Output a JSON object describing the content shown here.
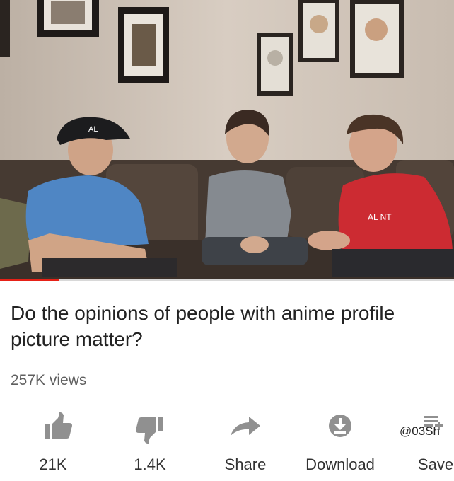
{
  "video": {
    "scene": "three-boys-on-couch",
    "cap_text": "AL",
    "shirt_text": "AL NT",
    "progress_fraction": 0.13
  },
  "title": "Do the opinions of people with anime profile picture matter?",
  "views": "257K views",
  "actions": [
    {
      "icon": "thumbs-up-icon",
      "label": "21K"
    },
    {
      "icon": "thumbs-down-icon",
      "label": "1.4K"
    },
    {
      "icon": "share-arrow-icon",
      "label": "Share"
    },
    {
      "icon": "download-icon",
      "label": "Download"
    },
    {
      "icon": "save-to-playlist-icon",
      "label": "Save"
    }
  ],
  "watermark": "@03Sh",
  "colors": {
    "progress": "#e62117",
    "icons": "#909090",
    "title": "#222222",
    "views": "#5f5f5f"
  }
}
